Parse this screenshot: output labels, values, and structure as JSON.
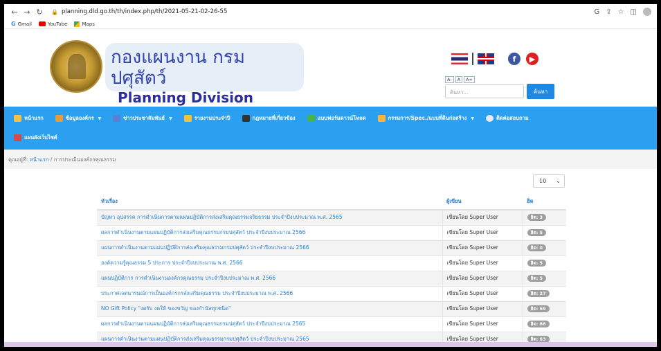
{
  "browser": {
    "url": "planning.dld.go.th/th/index.php/th/2021-05-21-02-26-55",
    "bookmarks": [
      "Gmail",
      "YouTube",
      "Maps"
    ]
  },
  "header": {
    "title_th": "กองแผนงาน กรมปศุสัตว์",
    "title_en": "Planning Division",
    "font_buttons": [
      "A-",
      "A",
      "A+"
    ],
    "search_placeholder": "ค้นหา...",
    "search_button": "ค้นหา"
  },
  "nav": {
    "items": [
      {
        "label": "หน้าแรก",
        "color": "#f5c04a"
      },
      {
        "label": "ข้อมูลองค์กร",
        "color": "#e89b3a"
      },
      {
        "label": "ข่าวประชาสัมพันธ์",
        "color": "#5b7fd6"
      },
      {
        "label": "รายงานประจำปี",
        "color": "#f2c23c"
      },
      {
        "label": "กฎหมายที่เกี่ยวข้อง",
        "color": "#333333"
      },
      {
        "label": "แบบฟอร์มดาวน์โหลด",
        "color": "#49b548"
      },
      {
        "label": "กรรมการ/Spec./แบบที่ดินก่อสร้าง",
        "color": "#f5b63b"
      },
      {
        "label": "ติดต่อสอบถาม",
        "color": "#e8e8f8"
      },
      {
        "label": "แผนผังเว็บไซต์",
        "color": "#d04b4b"
      }
    ]
  },
  "breadcrumb": {
    "prefix": "คุณอยู่ที่:",
    "home": "หน้าแรก",
    "separator": "/",
    "current": "การประเมินองค์กรคุณธรรม"
  },
  "table": {
    "per_page": "10",
    "headers": [
      "หัวเรื่อง",
      "ผู้เขียน",
      "ฮิต"
    ],
    "rows": [
      {
        "title": "ปัญหา อุปสรรค การดำเนินการตามแผนปฏิบัติการส่งเสริมคุณธรรมจริยธรรม ประจำปีงบประมาณ พ.ศ. 2565",
        "author": "เขียนโดย Super User",
        "hits": "ฮิต: 3"
      },
      {
        "title": "ผลการดำเนินงานตามแผนปฏิบัติการส่งเสริมคุณธรรมกรมปศุสัตว์ ประจำปีงบประมาณ 2566",
        "author": "เขียนโดย Super User",
        "hits": "ฮิต: 5"
      },
      {
        "title": "แผนการดำเนินงานตามแผนปฏิบัติการส่งเสริมคุณธรรมกรมปศุสัตว์ ประจำปีงบประมาณ 2566",
        "author": "เขียนโดย Super User",
        "hits": "ฮิต: 0"
      },
      {
        "title": "องค์ความรู้คุณธรรม 5 ประการ ประจำปีงบประมาณ พ.ศ. 2566",
        "author": "เขียนโดย Super User",
        "hits": "ฮิต: 5"
      },
      {
        "title": "แผนปฏิบัติการ การดำเนินงานองค์กรคุณธรรม ประจำปีงบประมาณ พ.ศ. 2566",
        "author": "เขียนโดย Super User",
        "hits": "ฮิต: 5"
      },
      {
        "title": "ประกาศเจตนารมณ์การเป็นองค์กรกรส่งเสริมคุณธรรม ประจำปีงบประมาณ พ.ศ. 2566",
        "author": "เขียนโดย Super User",
        "hits": "ฮิต: 27"
      },
      {
        "title": "NO Gift Policy \"งดรับ งดให้ ของขวัญ ของกำนัลทุกชนิด\"",
        "author": "เขียนโดย Super User",
        "hits": "ฮิต: 69"
      },
      {
        "title": "ผลการดำเนินงานตามแผนปฏิบัติการส่งเสริมคุณธรรมกรมปศุสัตว์ ประจำปีงบประมาณ 2565",
        "author": "เขียนโดย Super User",
        "hits": "ฮิต: 86"
      },
      {
        "title": "แผนการดำเนินงานตามแผนปฏิบัติการส่งเสริมคุณธรรมกรมปศุสัตว์ ประจำปีงบประมาณ 2565",
        "author": "เขียนโดย Super User",
        "hits": "ฮิต: 63"
      }
    ]
  }
}
